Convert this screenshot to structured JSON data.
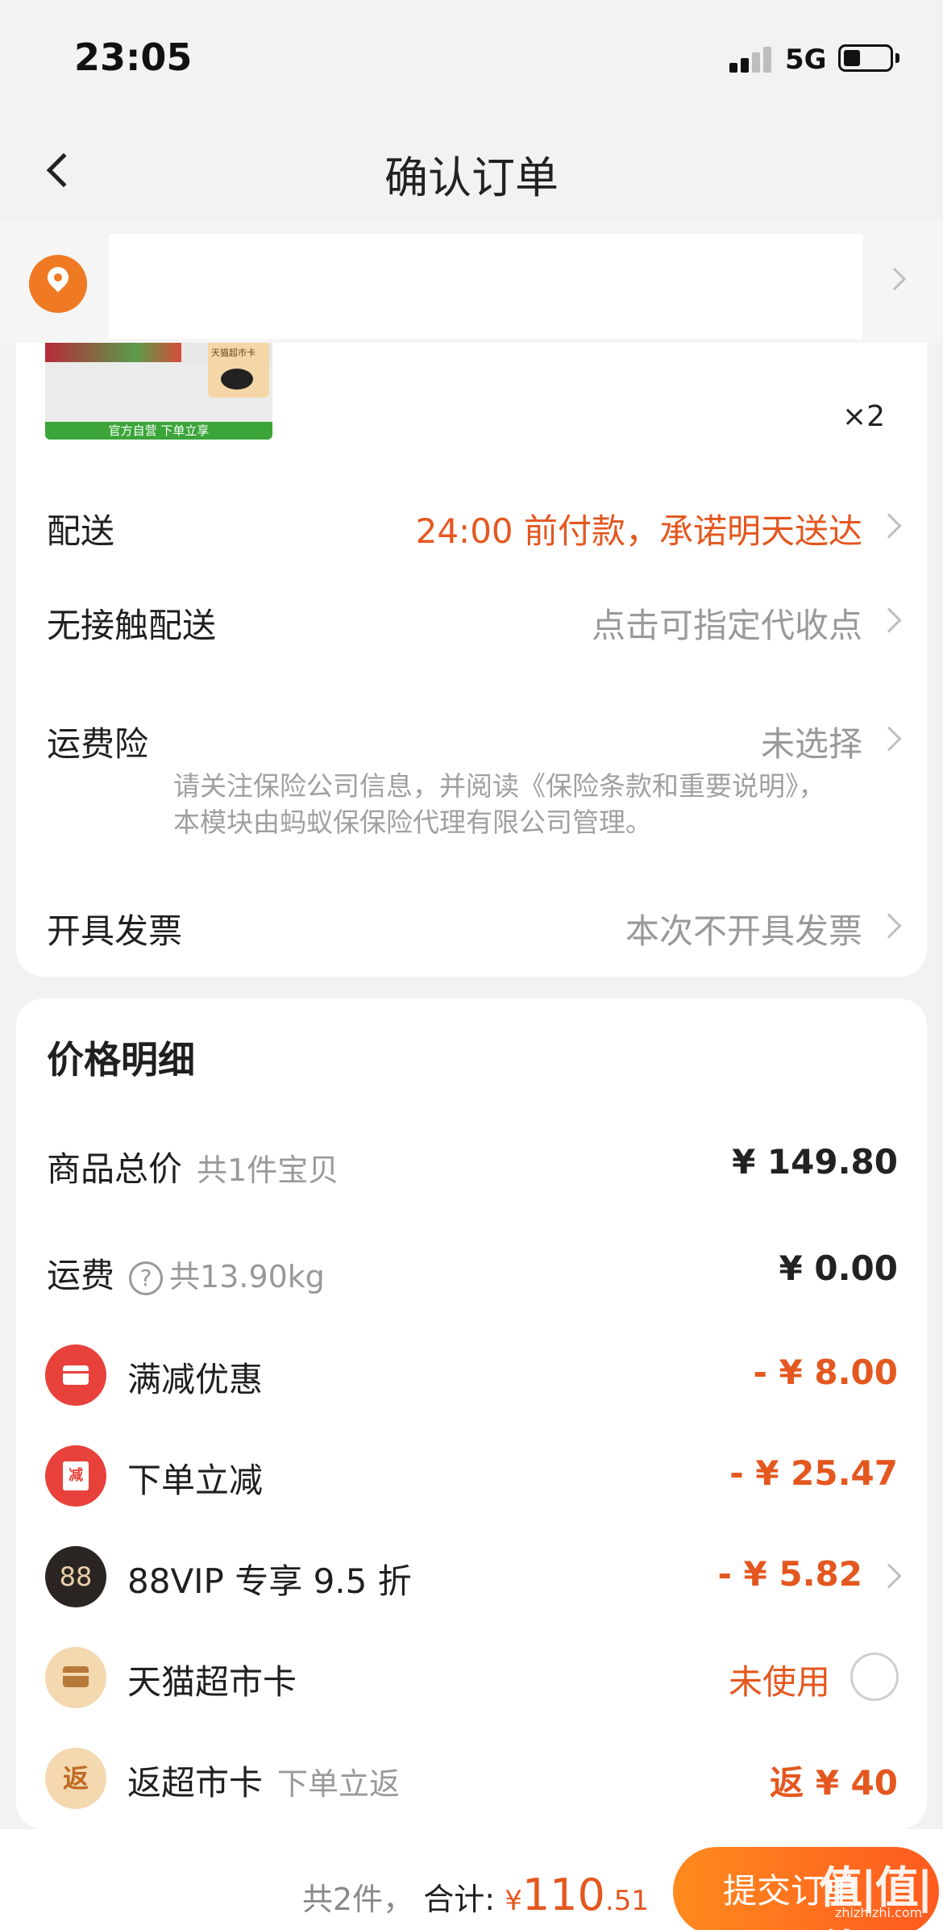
{
  "status_bar": {
    "time": "23:05",
    "network": "5G"
  },
  "nav": {
    "title": "确认订单"
  },
  "product": {
    "thumb_card_text": "天猫超市卡",
    "thumb_bar_text": "官方自营 下单立享",
    "quantity": "×2"
  },
  "rows": {
    "delivery": {
      "label": "配送",
      "value": "24:00 前付款，承诺明天送达"
    },
    "contactless": {
      "label": "无接触配送",
      "value": "点击可指定代收点"
    },
    "insurance": {
      "label": "运费险",
      "value": "未选择",
      "note": "请关注保险公司信息，并阅读《保险条款和重要说明》，本模块由蚂蚁保保险代理有限公司管理。"
    },
    "invoice": {
      "label": "开具发票",
      "value": "本次不开具发票"
    }
  },
  "price": {
    "title": "价格明细",
    "goods_total": {
      "label": "商品总价",
      "sub": "共1件宝贝",
      "value": "¥ 149.80"
    },
    "shipping": {
      "label": "运费",
      "sub": "共13.90kg",
      "value": "¥ 0.00",
      "help": "?"
    },
    "discount_full": {
      "label": "满减优惠",
      "value": "- ¥ 8.00"
    },
    "discount_order": {
      "label": "下单立减",
      "icon_text": "减",
      "value": "- ¥ 25.47"
    },
    "vip": {
      "label": "88VIP 专享 9.5 折",
      "icon_text": "88",
      "value": "- ¥ 5.82"
    },
    "tmall_card": {
      "label": "天猫超市卡",
      "value": "未使用"
    },
    "rebate": {
      "label": "返超市卡",
      "icon_text": "返",
      "sub": "下单立返",
      "value": "返 ¥ 40"
    }
  },
  "footer": {
    "count": "共2件，",
    "total_label": "合计:",
    "currency": "¥",
    "total_int": "110",
    "total_dec": ".51",
    "submit_label": "提交订单",
    "watermark": "值|值|值",
    "watermark_sub": "zhizhizhi.com"
  },
  "colors": {
    "accent": "#e4571f",
    "location_pin": "#f07a24",
    "discount_icon": "#e8413b",
    "vip_icon": "#2a2422"
  }
}
